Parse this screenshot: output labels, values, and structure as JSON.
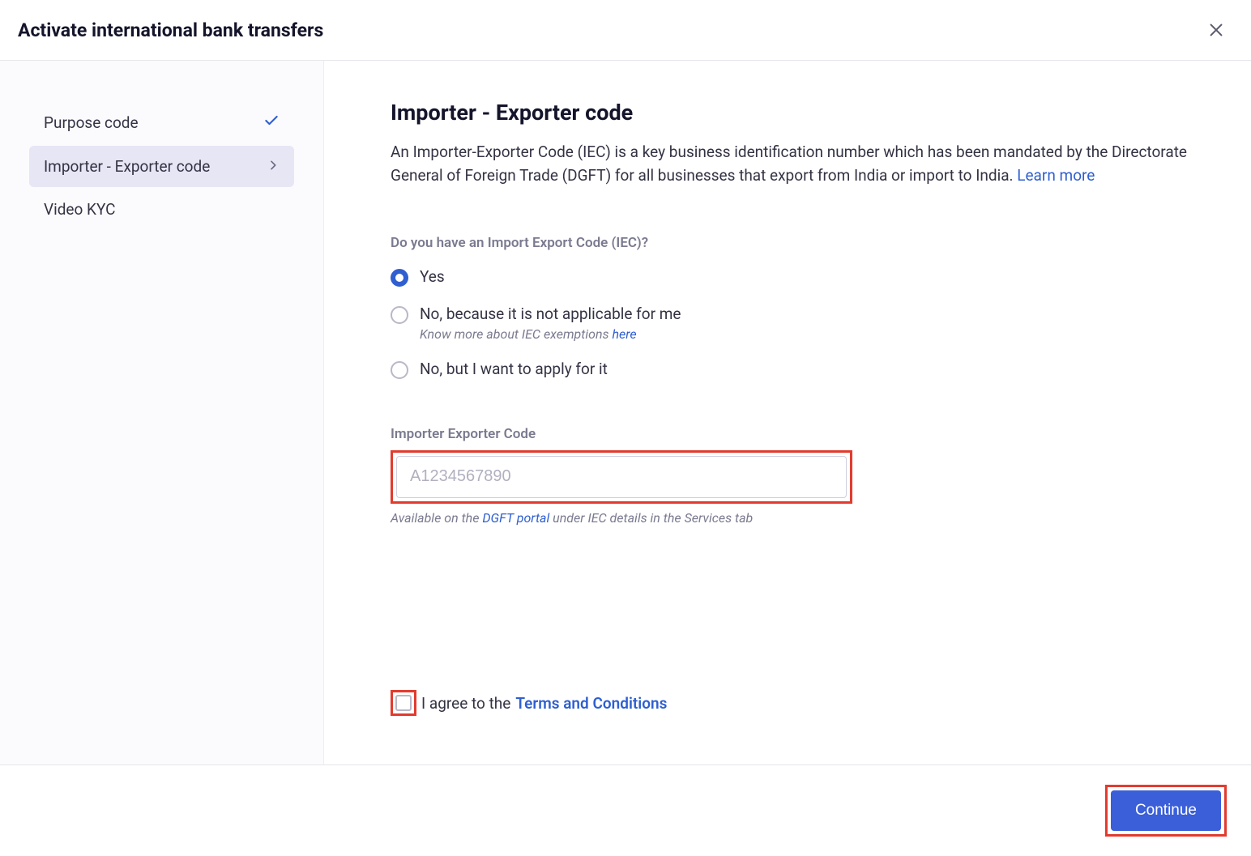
{
  "header": {
    "title": "Activate international bank transfers"
  },
  "sidebar": {
    "items": [
      {
        "label": "Purpose code",
        "status": "done"
      },
      {
        "label": "Importer - Exporter code",
        "status": "active"
      },
      {
        "label": "Video KYC",
        "status": "pending"
      }
    ]
  },
  "main": {
    "title": "Importer - Exporter code",
    "description": "An Importer-Exporter Code (IEC) is a key business identification number which has been mandated by the Directorate General of Foreign Trade (DGFT) for all businesses that export from India or import to India. ",
    "learn_more_label": "Learn more",
    "question_label": "Do you have an Import Export Code (IEC)?",
    "options": [
      {
        "label": "Yes",
        "selected": true
      },
      {
        "label": "No, because it is not applicable for me",
        "selected": false,
        "sub_prefix": "Know more about IEC exemptions ",
        "sub_link": "here"
      },
      {
        "label": "No, but I want to apply for it",
        "selected": false
      }
    ],
    "field": {
      "label": "Importer Exporter Code",
      "placeholder": "A1234567890",
      "value": "",
      "help_prefix": "Available on the ",
      "help_link": "DGFT portal",
      "help_suffix": " under IEC details in the Services tab"
    },
    "agree": {
      "checked": false,
      "text_prefix": "I agree to the ",
      "link_label": "Terms and Conditions"
    }
  },
  "footer": {
    "continue_label": "Continue"
  }
}
